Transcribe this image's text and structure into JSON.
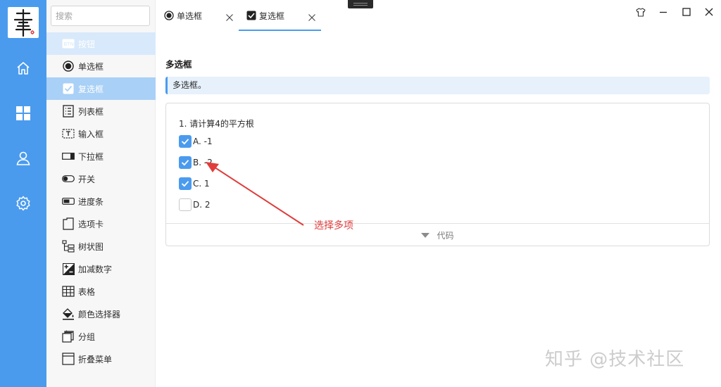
{
  "sidebar": {
    "search_placeholder": "搜索",
    "items": [
      {
        "label": "按钮",
        "icon": "button-icon"
      },
      {
        "label": "单选框",
        "icon": "radio-icon"
      },
      {
        "label": "复选框",
        "icon": "checkbox-icon"
      },
      {
        "label": "列表框",
        "icon": "listbox-icon"
      },
      {
        "label": "输入框",
        "icon": "textbox-icon"
      },
      {
        "label": "下拉框",
        "icon": "dropdown-icon"
      },
      {
        "label": "开关",
        "icon": "toggle-icon"
      },
      {
        "label": "进度条",
        "icon": "progressbar-icon"
      },
      {
        "label": "选项卡",
        "icon": "tab-icon"
      },
      {
        "label": "树状图",
        "icon": "treeview-icon"
      },
      {
        "label": "加减数字",
        "icon": "numeric-updown-icon"
      },
      {
        "label": "表格",
        "icon": "table-icon"
      },
      {
        "label": "颜色选择器",
        "icon": "paint-bucket-icon"
      },
      {
        "label": "分组",
        "icon": "group-icon"
      },
      {
        "label": "折叠菜单",
        "icon": "accordion-icon"
      }
    ],
    "active_index": 2
  },
  "tabs": [
    {
      "label": "单选框",
      "icon": "radio-icon"
    },
    {
      "label": "复选框",
      "icon": "checkbox-icon",
      "active": true
    }
  ],
  "page": {
    "title": "多选框",
    "tip": "多选框。",
    "question": "1. 请计算4的平方根",
    "options": [
      {
        "label": "A. -1",
        "checked": true
      },
      {
        "label": "B. -2",
        "checked": true
      },
      {
        "label": "C. 1",
        "checked": true
      },
      {
        "label": "D. 2",
        "checked": false
      }
    ],
    "code_label": "代码"
  },
  "annotation": "选择多项",
  "watermark": "知乎 @技术社区",
  "colors": {
    "accent": "#4a9bee",
    "annotation": "#e03c3c"
  }
}
